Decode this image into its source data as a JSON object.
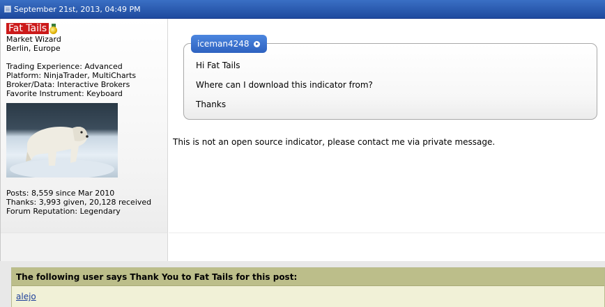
{
  "post": {
    "date": "September 21st, 2013, 04:49 PM"
  },
  "user": {
    "name": "Fat Tails",
    "title": "Market Wizard",
    "location": "Berlin, Europe",
    "experience": "Trading Experience: Advanced",
    "platform": "Platform: NinjaTrader, MultiCharts",
    "broker": "Broker/Data: Interactive Brokers",
    "instrument": "Favorite Instrument: Keyboard",
    "posts": "Posts: 8,559 since Mar 2010",
    "thanks": "Thanks: 3,993 given, 20,128 received",
    "reputation": "Forum Reputation: Legendary",
    "name_bg_color": "#cc1a1a"
  },
  "quote": {
    "author": "iceman4248",
    "lines": [
      "Hi Fat Tails",
      "Where can I download this indicator from?",
      "Thanks"
    ]
  },
  "reply": {
    "text": "This is not an open source indicator, please contact me via private message."
  },
  "thanks_box": {
    "header": "The following user says Thank You to Fat Tails for this post:",
    "users": [
      "alejo"
    ]
  },
  "colors": {
    "header_blue": "#1e4a9e",
    "quote_author_blue": "#2e62c0",
    "thanks_header": "#bcbe8a",
    "thanks_body": "#f1f1d7"
  }
}
